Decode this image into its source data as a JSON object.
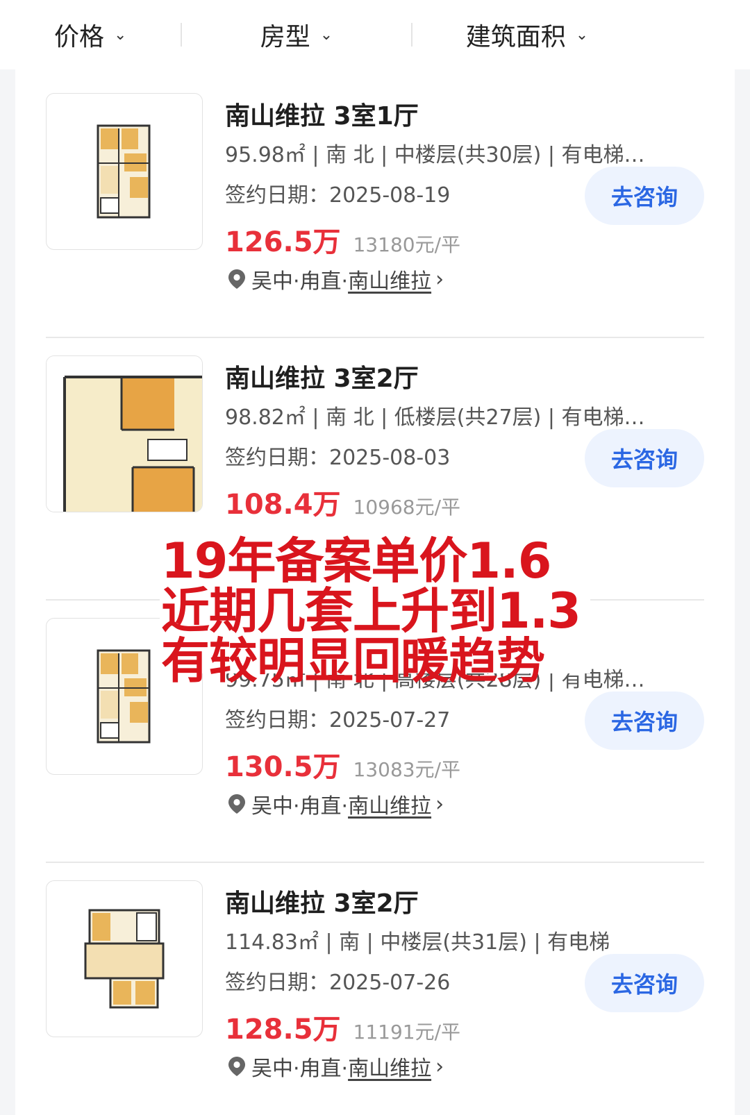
{
  "filters": [
    {
      "label": "价格"
    },
    {
      "label": "房型"
    },
    {
      "label": "建筑面积"
    }
  ],
  "listings": [
    {
      "title": "南山维拉 3室1厅",
      "specs": "95.98㎡ | 南 北 | 中楼层(共30层) | 有电梯…",
      "sign_date": "签约日期：2025-08-19",
      "price": "126.5万",
      "unit_price": "13180元/平",
      "loc_prefix": "吴中·甪直·",
      "community": "南山维拉",
      "consult_label": "去咨询"
    },
    {
      "title": "南山维拉 3室2厅",
      "specs": "98.82㎡ | 南 北 | 低楼层(共27层) | 有电梯…",
      "sign_date": "签约日期：2025-08-03",
      "price": "108.4万",
      "unit_price": "10968元/平",
      "loc_prefix": "",
      "community": "",
      "consult_label": "去咨询"
    },
    {
      "title": "",
      "specs": "99.75㎡ | 南 北 | 高楼层(共28层) | 有电梯…",
      "sign_date": "签约日期：2025-07-27",
      "price": "130.5万",
      "unit_price": "13083元/平",
      "loc_prefix": "吴中·甪直·",
      "community": "南山维拉",
      "consult_label": "去咨询"
    },
    {
      "title": "南山维拉 3室2厅",
      "specs": "114.83㎡ | 南 | 中楼层(共31层) | 有电梯",
      "sign_date": "签约日期：2025-07-26",
      "price": "128.5万",
      "unit_price": "11191元/平",
      "loc_prefix": "吴中·甪直·",
      "community": "南山维拉",
      "consult_label": "去咨询"
    }
  ],
  "overlay": {
    "lines": [
      "19年备案单价1.6",
      "近期几套上升到1.3",
      "有较明显回暖趋势"
    ]
  },
  "colors": {
    "price": "#e8303a",
    "consult_text": "#2b67e3",
    "consult_bg": "#edf3fe",
    "overlay_text": "#d9151d"
  },
  "icons": [
    "chevron-down-icon",
    "location-pin-icon",
    "chevron-right-icon",
    "floorplan-thumbnail"
  ]
}
